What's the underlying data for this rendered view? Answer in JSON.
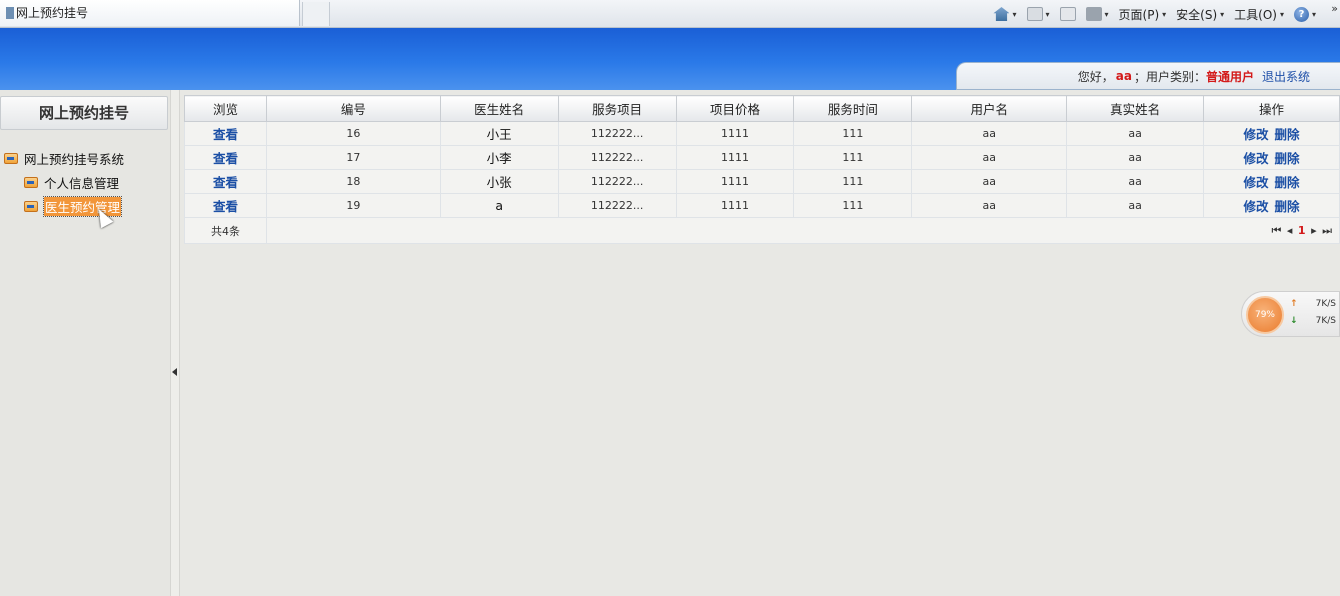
{
  "browser": {
    "tab_title": "网上预约挂号",
    "menu": {
      "page": "页面(P)",
      "safety": "安全(S)",
      "tools": "工具(O)"
    },
    "overflow": "»"
  },
  "userbar": {
    "greeting": "您好，",
    "username": "aa",
    "separator": "；",
    "type_label": "用户类别：",
    "user_type": "普通用户",
    "logout": "退出系统"
  },
  "sidebar": {
    "title": "网上预约挂号",
    "root": "网上预约挂号系统",
    "items": [
      {
        "label": "个人信息管理",
        "selected": false
      },
      {
        "label": "医生预约管理",
        "selected": true
      }
    ]
  },
  "table": {
    "columns": [
      "浏览",
      "编号",
      "医生姓名",
      "服务项目",
      "项目价格",
      "服务时间",
      "用户名",
      "真实姓名",
      "操作"
    ],
    "view_label": "查看",
    "edit_label": "修改",
    "delete_label": "删除",
    "rows": [
      {
        "id": "16",
        "doctor": "小王",
        "service": "112222...",
        "price": "1111",
        "time": "111",
        "username": "aa",
        "realname": "aa"
      },
      {
        "id": "17",
        "doctor": "小李",
        "service": "112222...",
        "price": "1111",
        "time": "111",
        "username": "aa",
        "realname": "aa"
      },
      {
        "id": "18",
        "doctor": "小张",
        "service": "112222...",
        "price": "1111",
        "time": "111",
        "username": "aa",
        "realname": "aa"
      },
      {
        "id": "19",
        "doctor": "a",
        "service": "112222...",
        "price": "1111",
        "time": "111",
        "username": "aa",
        "realname": "aa"
      }
    ],
    "total": "共4条",
    "pager": {
      "first": "⏮",
      "prev": "◂",
      "current": "1",
      "next": "▸",
      "last": "⏭"
    }
  },
  "speed_widget": {
    "percent": "79%",
    "up": "7K/S",
    "down": "7K/S"
  }
}
